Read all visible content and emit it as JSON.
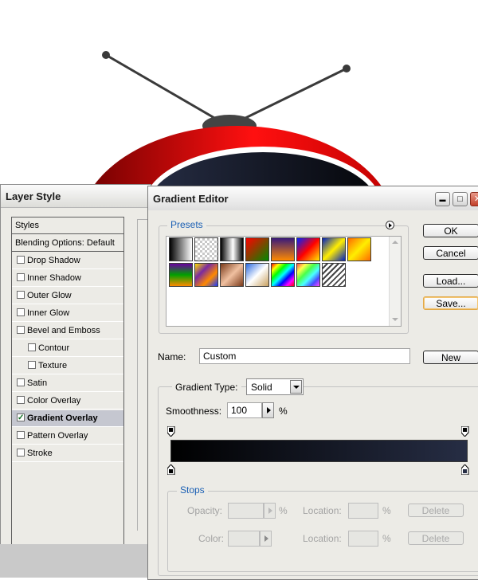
{
  "layer_style": {
    "title": "Layer Style",
    "items": [
      {
        "label": "Styles",
        "type": "header"
      },
      {
        "label": "Blending Options: Default",
        "type": "header"
      },
      {
        "label": "Drop Shadow",
        "checked": false
      },
      {
        "label": "Inner Shadow",
        "checked": false
      },
      {
        "label": "Outer Glow",
        "checked": false
      },
      {
        "label": "Inner Glow",
        "checked": false
      },
      {
        "label": "Bevel and Emboss",
        "checked": false
      },
      {
        "label": "Contour",
        "checked": false,
        "indent": true
      },
      {
        "label": "Texture",
        "checked": false,
        "indent": true
      },
      {
        "label": "Satin",
        "checked": false
      },
      {
        "label": "Color Overlay",
        "checked": false
      },
      {
        "label": "Gradient Overlay",
        "checked": true,
        "selected": true
      },
      {
        "label": "Pattern Overlay",
        "checked": false
      },
      {
        "label": "Stroke",
        "checked": false
      }
    ]
  },
  "gradient_editor": {
    "title": "Gradient Editor",
    "title_buttons": {
      "minimize": "▬",
      "maximize": "□",
      "close": "✕"
    },
    "presets": {
      "label": "Presets",
      "options_icon": "circle-arrow-icon",
      "row1": [
        "black-white",
        "transparent-checker",
        "black-white-black",
        "red-green",
        "violet-orange",
        "blue-red-yellow",
        "blue-yellow-blue",
        "orange-yellow-orange"
      ],
      "row2": [
        "violet-green-orange",
        "yellow-violet-orange-blue",
        "copper",
        "chrome",
        "spectrum",
        "transparent-rainbow",
        "transparent-stripes"
      ]
    },
    "buttons": {
      "ok": "OK",
      "cancel": "Cancel",
      "load": "Load...",
      "save": "Save...",
      "new": "New"
    },
    "name": {
      "label": "Name:",
      "value": "Custom"
    },
    "gradient_type": {
      "label": "Gradient Type:",
      "value": "Solid"
    },
    "smoothness": {
      "label": "Smoothness:",
      "value": "100",
      "unit": "%"
    },
    "gradient_colors": {
      "start": "#000000",
      "end": "#262d44"
    },
    "stops": {
      "label": "Stops",
      "opacity_label": "Opacity:",
      "opacity_unit": "%",
      "location_label": "Location:",
      "location_unit": "%",
      "color_label": "Color:",
      "delete_label": "Delete"
    }
  }
}
